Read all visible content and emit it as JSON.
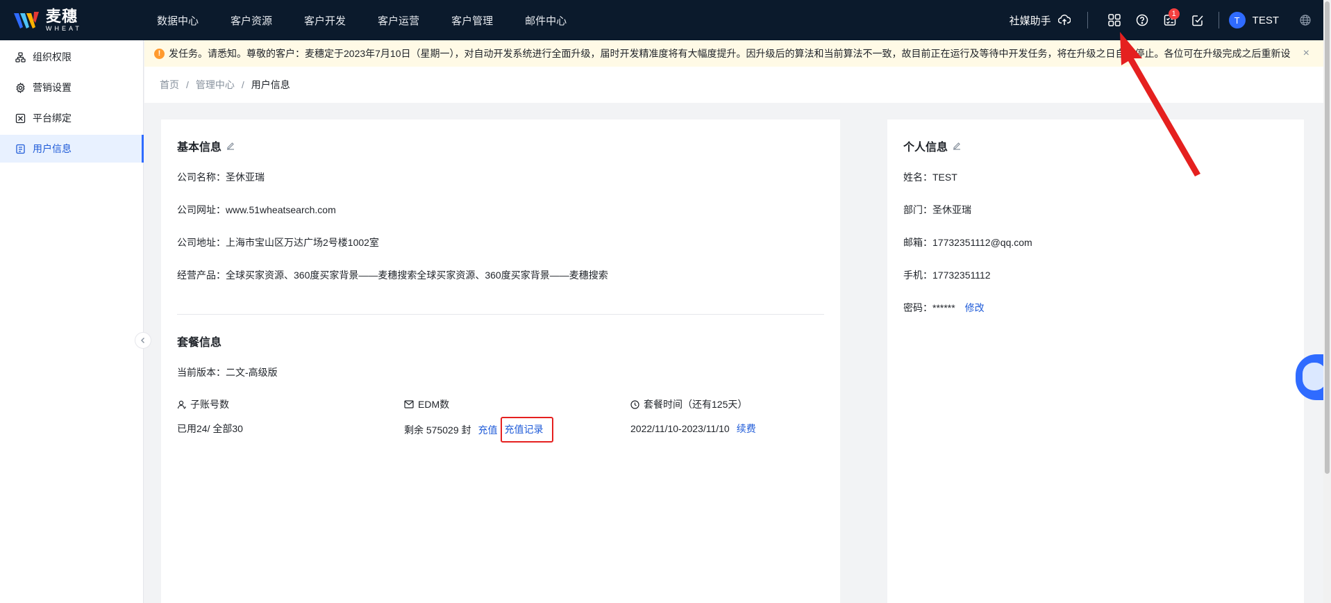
{
  "brand": {
    "name_cn": "麦穗",
    "name_en": "WHEAT"
  },
  "nav": [
    "数据中心",
    "客户资源",
    "客户开发",
    "客户运营",
    "客户管理",
    "邮件中心"
  ],
  "topbar": {
    "assistant_label": "社媒助手",
    "task_badge": "1",
    "user_initial": "T",
    "user_name": "TEST"
  },
  "sidebar": {
    "items": [
      {
        "label": "组织权限",
        "icon": "org-tree-icon"
      },
      {
        "label": "营销设置",
        "icon": "gear-icon"
      },
      {
        "label": "平台绑定",
        "icon": "bind-icon"
      },
      {
        "label": "用户信息",
        "icon": "user-doc-icon"
      }
    ]
  },
  "notice": {
    "text": "发任务。请悉知。尊敬的客户：麦穗定于2023年7月10日（星期一），对自动开发系统进行全面升级，届时开发精准度将有大幅度提升。因升级后的算法和当前算法不一致，故目前正在运行及等待中开发任务，将在升级之日自动停止。各位可在升级完成之后重新设",
    "close": "×"
  },
  "breadcrumb": {
    "home": "首页",
    "parent": "管理中心",
    "current": "用户信息",
    "sep": "/"
  },
  "basic": {
    "title": "基本信息",
    "company_name_label": "公司名称：",
    "company_name": "圣休亚瑞",
    "website_label": "公司网址：",
    "website": "www.51wheatsearch.com",
    "address_label": "公司地址：",
    "address": "上海市宝山区万达广场2号楼1002室",
    "products_label": "经营产品：",
    "products": "全球买家资源、360度买家背景——麦穗搜索全球买家资源、360度买家背景——麦穗搜索"
  },
  "package": {
    "title": "套餐信息",
    "version_label": "当前版本：",
    "version": "二文-高级版",
    "sub_accounts_head": "子账号数",
    "sub_accounts_value": "已用24/ 全部30",
    "edm_head": "EDM数",
    "edm_value": "剩余 575029 封",
    "recharge": "充值",
    "recharge_records": "充值记录",
    "period_head": "套餐时间（还有125天）",
    "period_value": "2022/11/10-2023/11/10",
    "renew": "续费"
  },
  "personal": {
    "title": "个人信息",
    "name_label": "姓名：",
    "name": "TEST",
    "dept_label": "部门：",
    "dept": "圣休亚瑞",
    "email_label": "邮箱：",
    "email": "17732351112@qq.com",
    "phone_label": "手机：",
    "phone": "17732351112",
    "password_label": "密码：",
    "password": "******",
    "modify": "修改"
  },
  "colors": {
    "accent": "#2f6bff",
    "link": "#1f5bd8",
    "nav_bg": "#0b1a2c",
    "notice_bg": "#fffae6",
    "annotation": "#e5201f"
  }
}
